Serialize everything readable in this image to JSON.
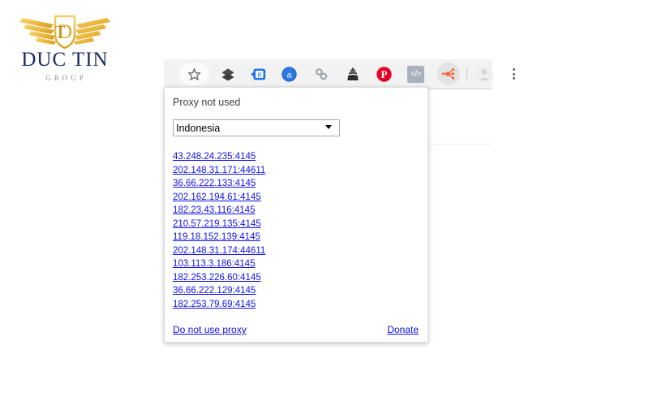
{
  "logo": {
    "mark": "winged-dt-monogram",
    "name": "DUC TIN",
    "subtitle": "GROUP",
    "gold": "#e9b53a",
    "navy": "#1b2a5e",
    "gray": "#8e8e8e"
  },
  "toolbar": {
    "icons": [
      {
        "name": "bookmark-star-icon",
        "glyph": "☆"
      },
      {
        "name": "diamond-layers-icon",
        "glyph": ""
      },
      {
        "name": "blue-tag-icon",
        "glyph": ""
      },
      {
        "name": "alexa-a-icon",
        "glyph": "a"
      },
      {
        "name": "chain-links-icon",
        "glyph": ""
      },
      {
        "name": "evernote-elephant-icon",
        "glyph": ""
      },
      {
        "name": "pinterest-icon",
        "glyph": ""
      },
      {
        "name": "code-view-icon",
        "glyph": "</>"
      },
      {
        "name": "proxy-node-graph-icon",
        "glyph": ""
      }
    ],
    "avatar_label": "",
    "menu_label": "",
    "accent_orange": "#f4663a",
    "pinterest_red": "#e60023",
    "alexa_blue": "#2a6ed6"
  },
  "popup": {
    "status": "Proxy not used",
    "country": {
      "selected": "Indonesia",
      "options": [
        "Indonesia"
      ]
    },
    "proxies": [
      "43.248.24.235:4145",
      "202.148.31.171:44611",
      "36.66.222.133:4145",
      "202.162.194.61:4145",
      "182.23.43.116:4145",
      "210.57.219.135:4145",
      "119.18.152.139:4145",
      "202.148.31.174:44611",
      "103.113.3.186:4145",
      "182.253.226.60:4145",
      "36.66.222.129:4145",
      "182.253.79.69:4145"
    ],
    "footer": {
      "disable": "Do not use proxy",
      "donate": "Donate"
    },
    "link_color": "#1111ee"
  }
}
